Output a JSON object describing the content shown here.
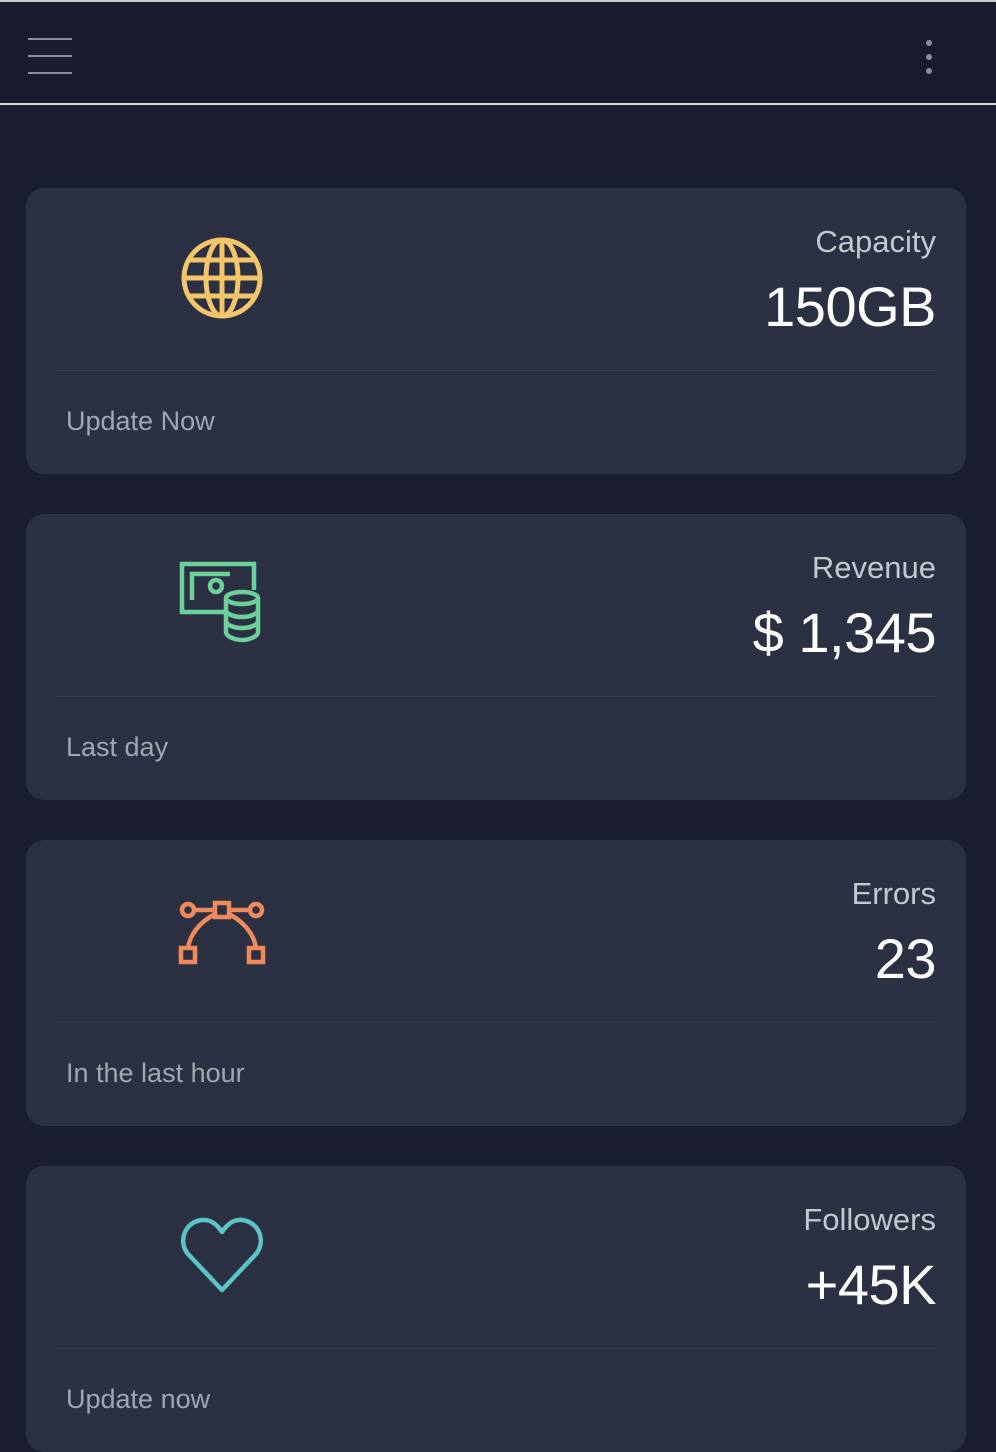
{
  "navbar": {
    "menu_icon": "hamburger-menu-icon",
    "more_icon": "vertical-ellipsis-icon"
  },
  "cards": [
    {
      "title": "Capacity",
      "value": "150GB",
      "footer": "Update Now",
      "icon": "globe-icon",
      "icon_color": "#f5c56a"
    },
    {
      "title": "Revenue",
      "value": "$ 1,345",
      "footer": "Last day",
      "icon": "money-coins-icon",
      "icon_color": "#6dcf9a"
    },
    {
      "title": "Errors",
      "value": "23",
      "footer": "In the last hour",
      "icon": "vector-curve-icon",
      "icon_color": "#ef8a5c"
    },
    {
      "title": "Followers",
      "value": "+45K",
      "footer": "Update now",
      "icon": "heart-icon",
      "icon_color": "#5cc4c7"
    }
  ],
  "theme": {
    "background": "#1a1e2f",
    "card_background": "#2b3043"
  }
}
